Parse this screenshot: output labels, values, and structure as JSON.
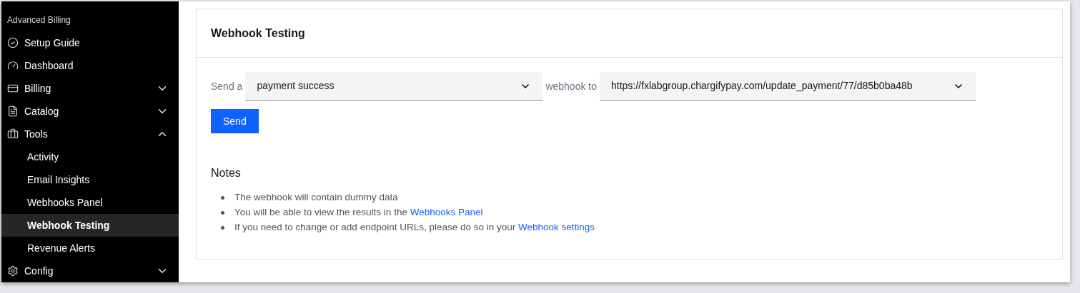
{
  "sidebar": {
    "title": "Advanced Billing",
    "items": [
      {
        "label": "Setup Guide",
        "selected": false
      },
      {
        "label": "Dashboard",
        "selected": false
      },
      {
        "label": "Billing",
        "expanded": false,
        "selected": false
      },
      {
        "label": "Catalog",
        "expanded": false,
        "selected": false
      },
      {
        "label": "Tools",
        "expanded": true,
        "selected": false,
        "children": [
          {
            "label": "Activity",
            "selected": false
          },
          {
            "label": "Email Insights",
            "selected": false
          },
          {
            "label": "Webhooks Panel",
            "selected": false
          },
          {
            "label": "Webhook Testing",
            "selected": true
          },
          {
            "label": "Revenue Alerts",
            "selected": false
          }
        ]
      },
      {
        "label": "Config",
        "expanded": false,
        "selected": false
      }
    ]
  },
  "card": {
    "title": "Webhook Testing",
    "form": {
      "prefix": "Send a",
      "event": "payment success",
      "middle": "webhook to",
      "url": "https://fxlabgroup.chargifypay.com/update_payment/77/d85b0ba48b",
      "button": "Send"
    },
    "notes": {
      "title": "Notes",
      "items": [
        {
          "text": "The webhook will contain dummy data"
        },
        {
          "text": "You will be able to view the results in the",
          "link": "Webhooks Panel"
        },
        {
          "text": "If you need to change or add endpoint URLs, please do so in your",
          "link": "Webhook settings"
        }
      ]
    }
  }
}
